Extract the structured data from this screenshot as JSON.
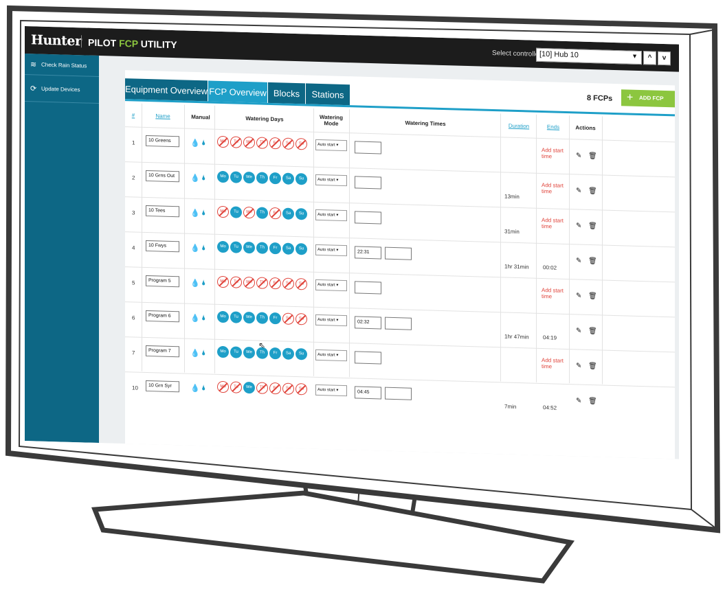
{
  "app": {
    "logo": "Hunter",
    "title_prefix": "PILOT ",
    "title_accent": "FCP",
    "title_suffix": " UTILITY"
  },
  "controller": {
    "label": "Select controller:",
    "value": "[10] Hub 10",
    "up_label": "^",
    "down_label": "v"
  },
  "sidebar": {
    "items": [
      {
        "icon": "wifi-icon",
        "label": "Check Rain Status"
      },
      {
        "icon": "refresh-icon",
        "label": "Update Devices"
      }
    ]
  },
  "tabs": [
    {
      "label": "Equipment Overview",
      "active": false
    },
    {
      "label": "FCP Overview",
      "active": true
    },
    {
      "label": "Blocks",
      "active": false
    },
    {
      "label": "Stations",
      "active": false
    }
  ],
  "toolbar": {
    "fcp_count": "8 FCPs",
    "add_label": "ADD FCP",
    "add_icon": "+"
  },
  "table": {
    "headers": {
      "num": "#",
      "name": "Name",
      "manual": "Manual",
      "days": "Watering Days",
      "mode": "Watering Mode",
      "times": "Watering Times",
      "duration": "Duration",
      "ends": "Ends",
      "actions": "Actions"
    },
    "day_labels": [
      "Mo",
      "Tu",
      "We",
      "Th",
      "Fr",
      "Sa",
      "Su"
    ],
    "rows": [
      {
        "num": "1",
        "name": "10 Greens",
        "days": [
          false,
          false,
          false,
          false,
          false,
          false,
          false
        ],
        "mode": "Auto start",
        "times": [
          ""
        ],
        "duration": "",
        "ends": "Add start time",
        "ends_is_link": true
      },
      {
        "num": "2",
        "name": "10 Grns Out",
        "days": [
          true,
          true,
          true,
          true,
          true,
          true,
          true
        ],
        "mode": "Auto start",
        "times": [
          ""
        ],
        "duration": "13min",
        "ends": "Add start time",
        "ends_is_link": true
      },
      {
        "num": "3",
        "name": "10 Tees",
        "days": [
          false,
          true,
          false,
          true,
          false,
          true,
          true
        ],
        "mode": "Auto start",
        "times": [
          ""
        ],
        "duration": "31min",
        "ends": "Add start time",
        "ends_is_link": true
      },
      {
        "num": "4",
        "name": "10 Fwys",
        "days": [
          true,
          true,
          true,
          true,
          true,
          true,
          true
        ],
        "mode": "Auto start",
        "times": [
          "22:31",
          ""
        ],
        "duration": "1hr 31min",
        "ends": "00:02",
        "ends_is_link": false
      },
      {
        "num": "5",
        "name": "Program 5",
        "days": [
          false,
          false,
          false,
          false,
          false,
          false,
          false
        ],
        "mode": "Auto start",
        "times": [
          ""
        ],
        "duration": "",
        "ends": "Add start time",
        "ends_is_link": true
      },
      {
        "num": "6",
        "name": "Program 6",
        "days": [
          true,
          true,
          true,
          true,
          true,
          false,
          false
        ],
        "mode": "Auto start",
        "times": [
          "02:32",
          ""
        ],
        "duration": "1hr 47min",
        "ends": "04:19",
        "ends_is_link": false
      },
      {
        "num": "7",
        "name": "Program 7",
        "days": [
          true,
          true,
          true,
          true,
          true,
          true,
          true
        ],
        "mode": "Auto start",
        "times": [
          ""
        ],
        "duration": "",
        "ends": "Add start time",
        "ends_is_link": true
      },
      {
        "num": "10",
        "name": "10 Grn Syr",
        "days": [
          false,
          false,
          true,
          false,
          false,
          false,
          false
        ],
        "mode": "Auto start",
        "times": [
          "04:45",
          ""
        ],
        "duration": "7min",
        "ends": "04:52",
        "ends_is_link": false
      }
    ]
  },
  "colors": {
    "teal": "#0d6785",
    "accent_blue": "#1e9fc8",
    "green": "#8cc63f",
    "red": "#e0433a"
  }
}
